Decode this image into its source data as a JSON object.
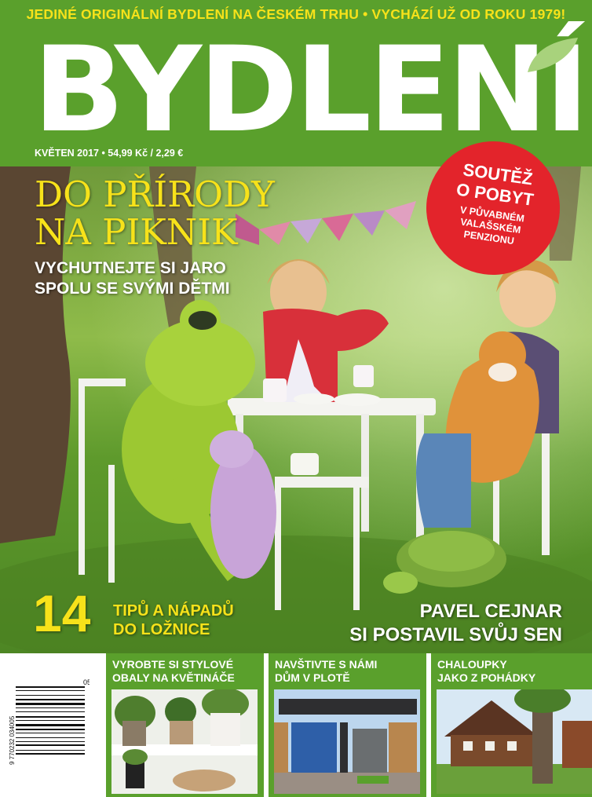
{
  "cover": {
    "tagline": "JEDINÉ ORIGINÁLNÍ BYDLENÍ NA ČESKÉM TRHU • VYCHÁZÍ UŽ OD ROKU 1979!",
    "title": "BYDLENÍ",
    "issue": "KVĚTEN 2017 • 54,99 Kč / 2,29 €"
  },
  "headline": {
    "line1": "DO PŘÍRODY",
    "line2": "NA PIKNIK",
    "sub1": "VYCHUTNEJTE SI JARO",
    "sub2": "SPOLU SE SVÝMI DĚTMI"
  },
  "contest": {
    "line1": "SOUTĚŽ",
    "line2": "O POBYT",
    "line3": "V PŮVABNÉM",
    "line4": "VALAŠSKÉM",
    "line5": "PENZIONU"
  },
  "tips": {
    "number": "14",
    "line1": "TIPŮ A NÁPADŮ",
    "line2": "DO LOŽNICE"
  },
  "feature": {
    "line1": "PAVEL CEJNAR",
    "line2": "SI POSTAVIL SVŮJ SEN"
  },
  "teasers": [
    {
      "line1": "VYROBTE SI STYLOVÉ",
      "line2": "OBALY NA KVĚTINÁČE"
    },
    {
      "line1": "NAVŠTIVTE S NÁMI",
      "line2": "DŮM V PLOTĚ"
    },
    {
      "line1": "CHALOUPKY",
      "line2": "JAKO Z POHÁDKY"
    }
  ],
  "barcode": {
    "issue_number": "05",
    "digits": "9 770232 034005"
  },
  "colors": {
    "brand_green": "#5aa02c",
    "accent_yellow": "#f7e21a",
    "contest_red": "#e3242b"
  }
}
